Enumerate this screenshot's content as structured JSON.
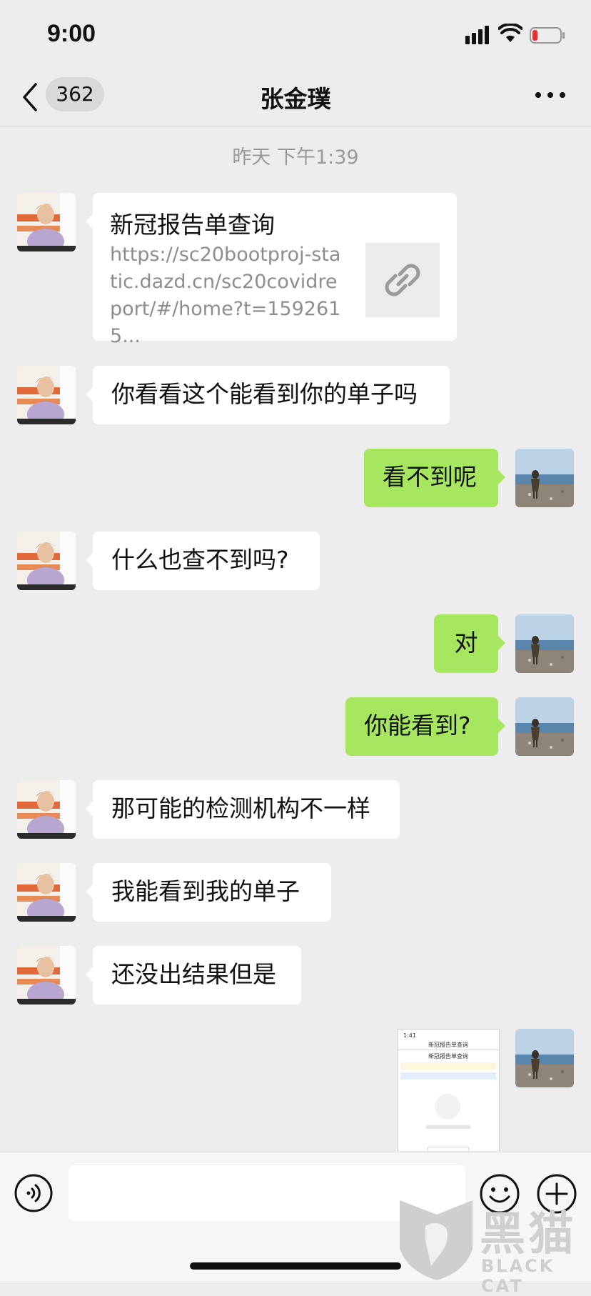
{
  "status_bar": {
    "time": "9:00"
  },
  "nav": {
    "unread_count": "362",
    "contact_name": "张金璞"
  },
  "timestamp": "昨天 下午1:39",
  "link_card": {
    "title": "新冠报告单查询",
    "url": "https://sc20bootproj-static.dazd.cn/sc20covidreport/#/home?t=1592615..."
  },
  "messages": [
    {
      "side": "left",
      "text": "你看看这个能看到你的单子吗"
    },
    {
      "side": "right",
      "text": "看不到呢"
    },
    {
      "side": "left",
      "text": "什么也查不到吗?"
    },
    {
      "side": "right",
      "text": "对"
    },
    {
      "side": "right",
      "text": "你能看到?"
    },
    {
      "side": "left",
      "text": "那可能的检测机构不一样"
    },
    {
      "side": "left",
      "text": "我能看到我的单子"
    },
    {
      "side": "left",
      "text": "还没出结果但是"
    }
  ],
  "screenshot_thumb": {
    "time": "1:41",
    "title": "新冠报告单查询",
    "subtitle": "新冠报告单查询"
  },
  "watermark": {
    "text": "黑猫",
    "sub": "BLACK CAT"
  },
  "colors": {
    "sent_bubble": "#a6e75f",
    "received_bubble": "#ffffff",
    "background": "#ededed"
  }
}
